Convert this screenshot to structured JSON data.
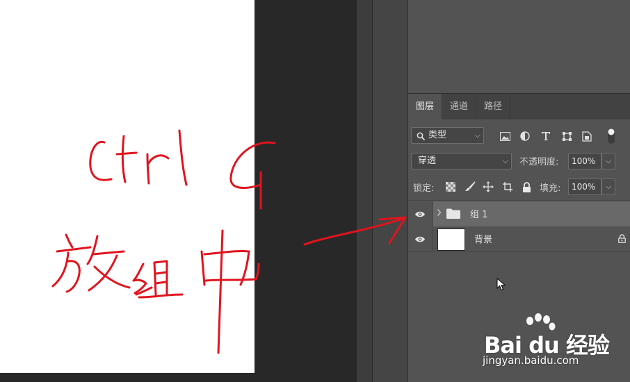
{
  "tabs": [
    {
      "label": "图层",
      "active": true
    },
    {
      "label": "通道",
      "active": false
    },
    {
      "label": "路径",
      "active": false
    }
  ],
  "filter": {
    "kind_label": "类型",
    "icons": [
      "image-filter-icon",
      "adjustment-filter-icon",
      "type-filter-icon",
      "shape-filter-icon",
      "smart-object-filter-icon",
      "filter-toggle-icon"
    ]
  },
  "blend": {
    "mode": "穿透",
    "opacity_label": "不透明度:",
    "opacity_value": "100%"
  },
  "lock": {
    "label": "锁定:",
    "icons": [
      "lock-transparent-pixels-icon",
      "lock-image-pixels-icon",
      "lock-position-icon",
      "lock-artboard-icon",
      "lock-all-icon"
    ],
    "fill_label": "填充:",
    "fill_value": "100%"
  },
  "layers": [
    {
      "name": "组 1",
      "type": "group",
      "visible": true,
      "selected": true
    },
    {
      "name": "背景",
      "type": "background",
      "visible": true,
      "locked": true
    }
  ],
  "annotation": {
    "handwriting": [
      "ctrl G",
      "放组中"
    ],
    "color": "#e0141e"
  },
  "watermark": {
    "brand": "Bai du 经验",
    "url": "jingyan.baidu.com"
  },
  "colors": {
    "panel_bg": "#535353",
    "tabbar_bg": "#424242",
    "selected_row": "#696969",
    "canvas_bg": "#282828"
  }
}
